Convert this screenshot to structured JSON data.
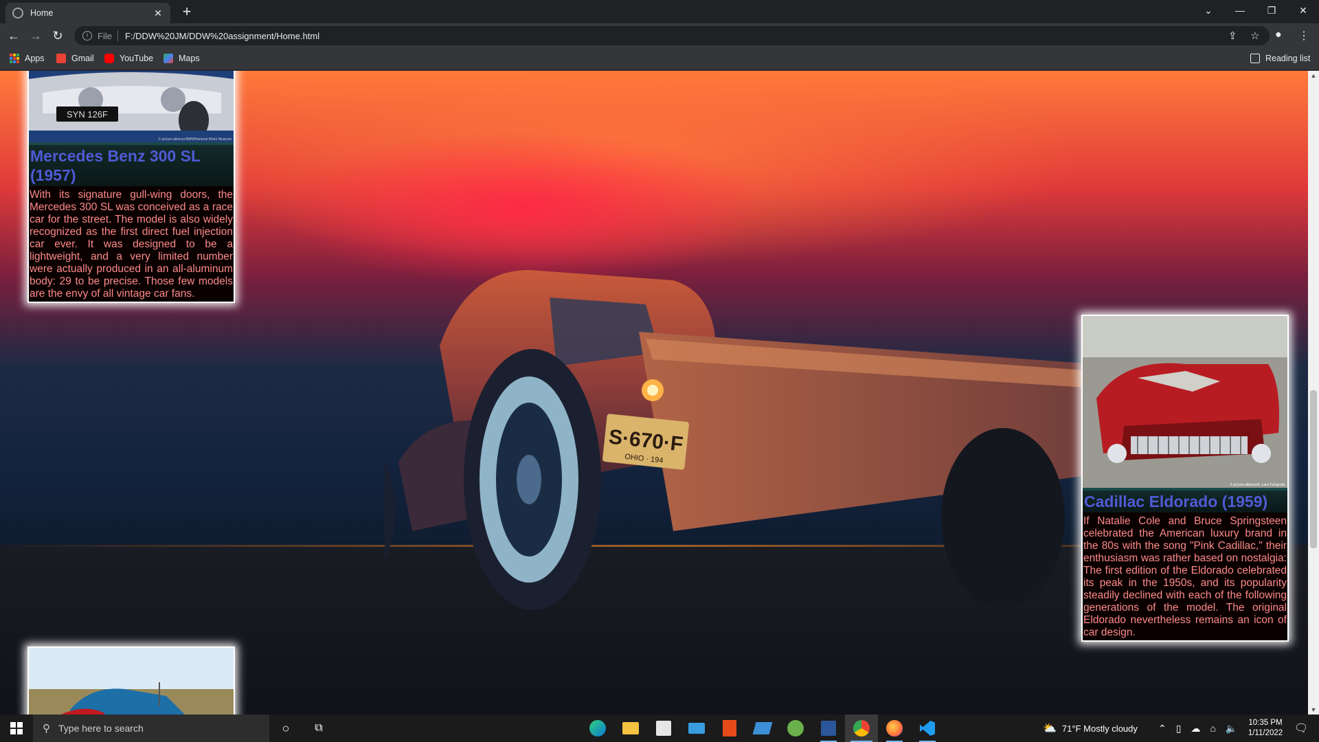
{
  "browser": {
    "tab_title": "Home",
    "scheme": "File",
    "url": "F:/DDW%20JM/DDW%20assignment/Home.html",
    "reading_list": "Reading list",
    "bookmarks": [
      {
        "label": "Apps",
        "icon": "apps-grid-icon"
      },
      {
        "label": "Gmail",
        "icon": "gmail-icon",
        "color": "#ea4335"
      },
      {
        "label": "YouTube",
        "icon": "youtube-icon",
        "color": "#ff0000"
      },
      {
        "label": "Maps",
        "icon": "maps-icon",
        "color": "#34a853"
      }
    ]
  },
  "page": {
    "cars": [
      {
        "name": "Mercedes Benz 300 SL (1957)",
        "description": "With its signature gull-wing doors, the Mercedes 300 SL was conceived as a race car for the street. The model is also widely recognized as the first direct fuel injection car ever. It was designed to be a lightweight, and a very limited number were actually produced in an all-aluminum body: 29 to be precise. Those few models are the envy of all vintage car fans.",
        "plate": "SYN 126F",
        "photo_credit": "© picture-alliance/NMM/National Motor Museum"
      },
      {
        "name": "Cadillac Eldorado (1959)",
        "description": "If Natalie Cole and Bruce Springsteen celebrated the American luxury brand in the 80s with the song \"Pink Cadillac,\" their enthusiasm was rather based on nostalgia: The first edition of the Eldorado celebrated its peak in the 1950s, and its popularity steadily declined with each of the following generations of the model. The original Eldorado nevertheless remains an icon of car design.",
        "photo_credit": "© picture-alliance/A. Lack Fotografie"
      }
    ],
    "truck_plate": "S·670·F",
    "truck_plate_sub": "OHIO · 194"
  },
  "taskbar": {
    "search_placeholder": "Type here to search",
    "weather": "71°F  Mostly cloudy",
    "time": "10:35 PM",
    "date": "1/11/2022"
  }
}
